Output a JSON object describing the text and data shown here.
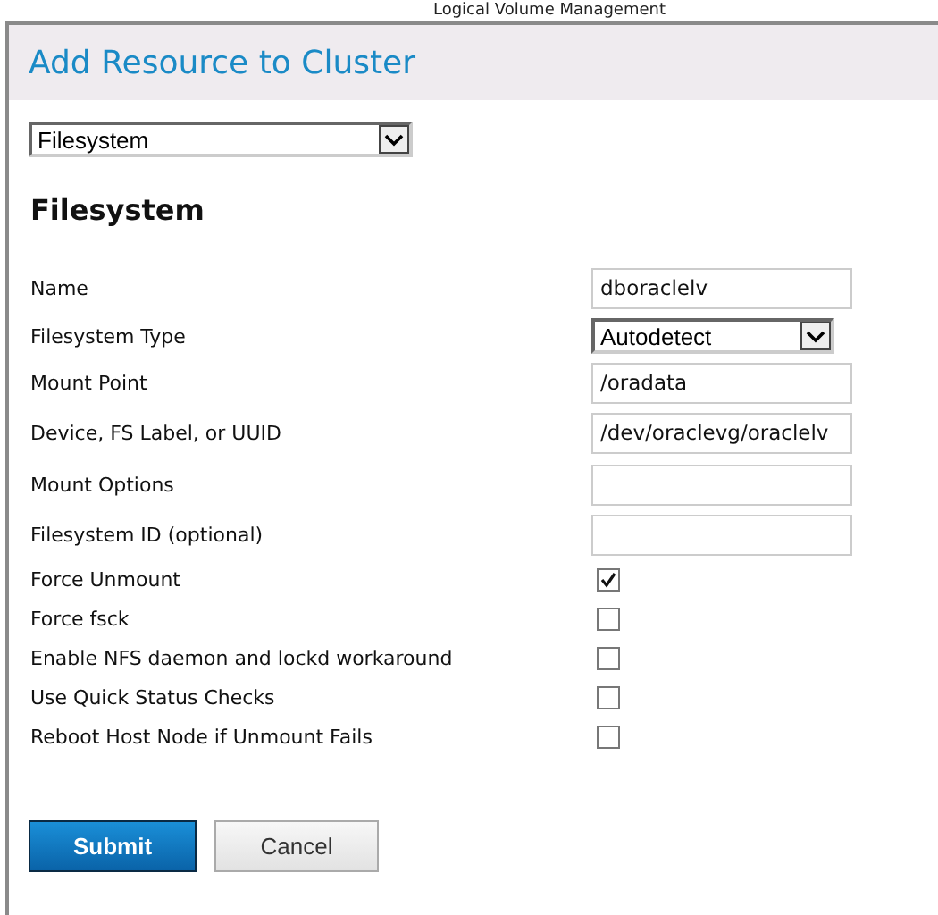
{
  "background_title": "Logical Volume Management",
  "dialog": {
    "title": "Add Resource to Cluster",
    "resource_type": {
      "value": "Filesystem"
    },
    "section_title": "Filesystem",
    "fields": [
      {
        "kind": "text",
        "label": "Name",
        "value": "dboraclelv"
      },
      {
        "kind": "select",
        "label": "Filesystem Type",
        "value": "Autodetect"
      },
      {
        "kind": "text",
        "label": "Mount Point",
        "value": "/oradata"
      },
      {
        "kind": "text",
        "label": "Device, FS Label, or UUID",
        "value": "/dev/oraclevg/oraclelv"
      },
      {
        "kind": "text",
        "label": "Mount Options"
      },
      {
        "kind": "text",
        "label": "Filesystem ID (optional)"
      },
      {
        "kind": "checkbox",
        "label": "Force Unmount",
        "checked": true
      },
      {
        "kind": "checkbox",
        "label": "Force fsck",
        "checked": false
      },
      {
        "kind": "checkbox",
        "label": "Enable NFS daemon and lockd workaround",
        "checked": false
      },
      {
        "kind": "checkbox",
        "label": "Use Quick Status Checks",
        "checked": false
      },
      {
        "kind": "checkbox",
        "label": "Reboot Host Node if Unmount Fails",
        "checked": false
      }
    ],
    "buttons": [
      {
        "kind": "primary",
        "label": "Submit"
      },
      {
        "kind": "secondary",
        "label": "Cancel"
      }
    ]
  }
}
